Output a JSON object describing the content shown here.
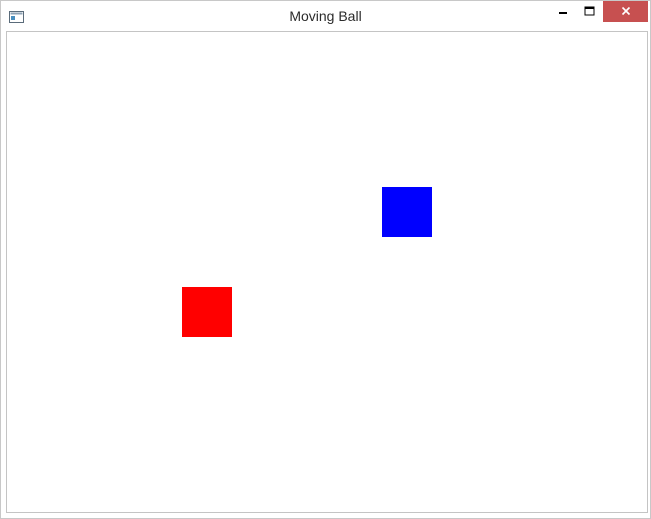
{
  "window": {
    "title": "Moving Ball"
  },
  "titlebar": {
    "icons": {
      "app": "app-window-icon",
      "minimize": "minimize-icon",
      "maximize": "maximize-icon",
      "close": "close-icon"
    }
  },
  "canvas": {
    "background": "#ffffff",
    "shapes": [
      {
        "name": "blue-square",
        "color": "#0000ff"
      },
      {
        "name": "red-square",
        "color": "#ff0000"
      }
    ]
  },
  "colors": {
    "close_button": "#c75050",
    "border": "#c8c8c8"
  }
}
